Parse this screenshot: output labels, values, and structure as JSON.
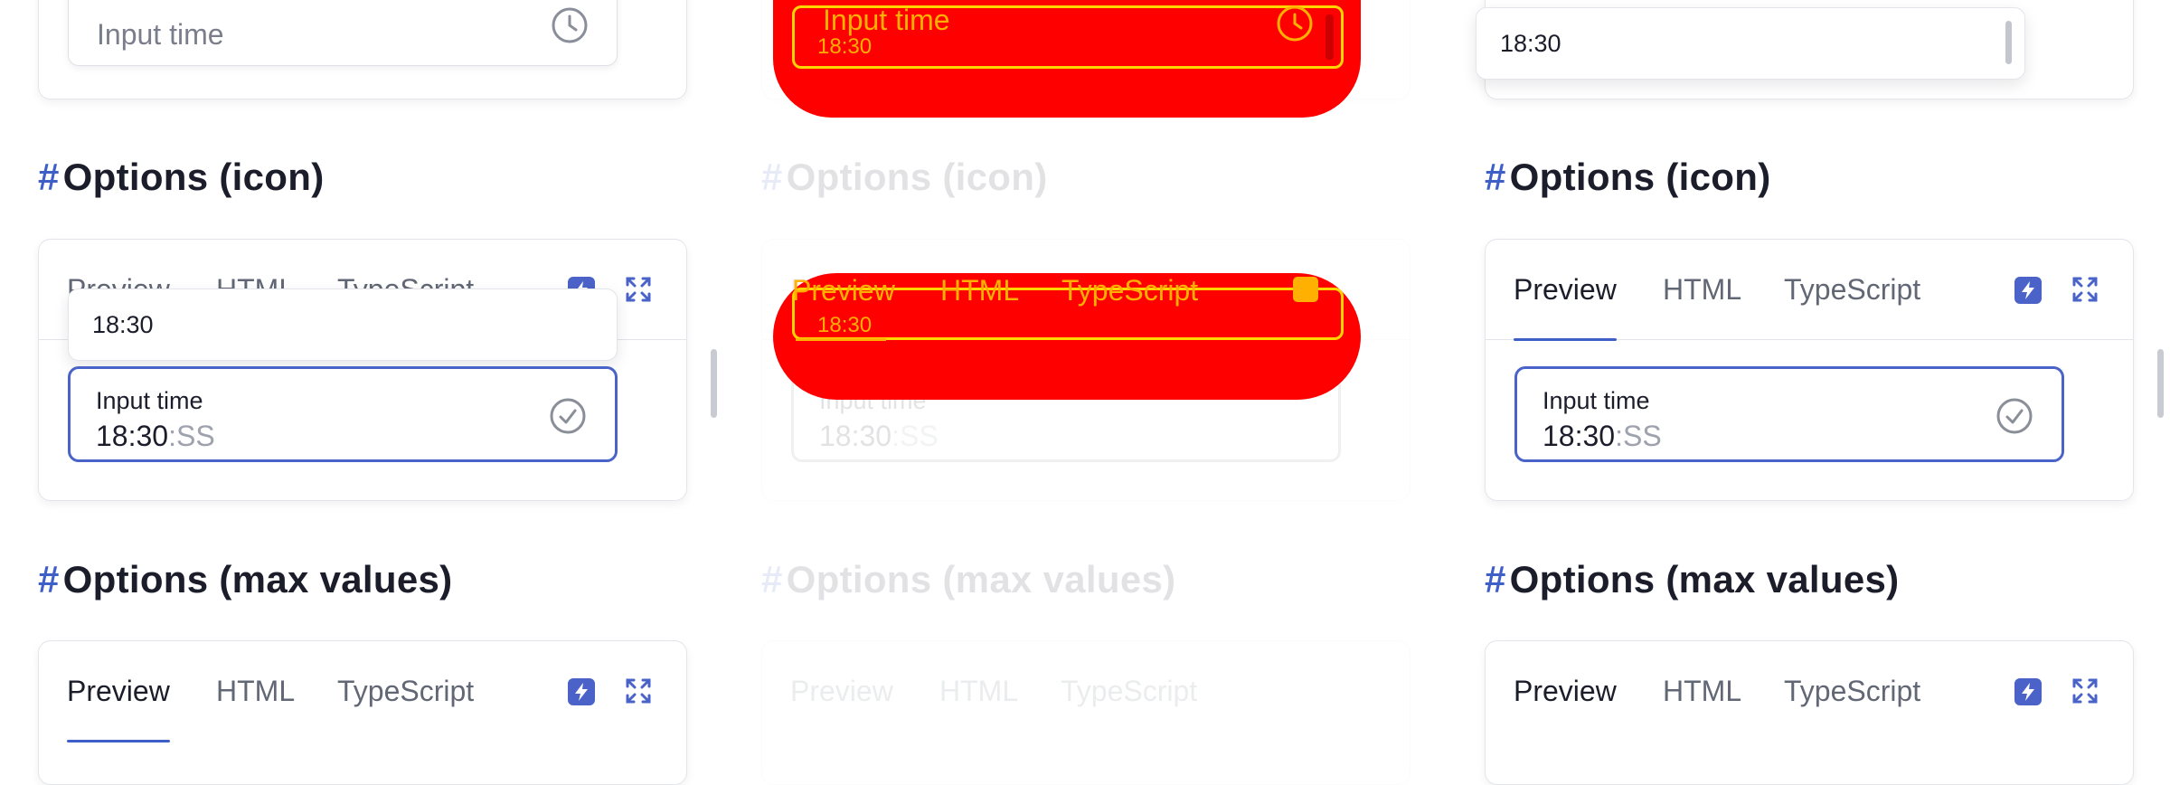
{
  "tabs": {
    "preview": "Preview",
    "html": "HTML",
    "typescript": "TypeScript"
  },
  "headings": {
    "hash": "#",
    "icon": "Options (icon)",
    "max": "Options (max values)"
  },
  "top_field": {
    "placeholder": "Input time",
    "dropdown_option": "18:30"
  },
  "icon_field": {
    "label": "Input time",
    "value_main": "18:30",
    "value_seconds": ":SS",
    "dropdown_option": "18:30"
  },
  "colors": {
    "accent": "#4a63c9",
    "overlay": "#ff0000",
    "overlay_text": "#ffb000"
  }
}
